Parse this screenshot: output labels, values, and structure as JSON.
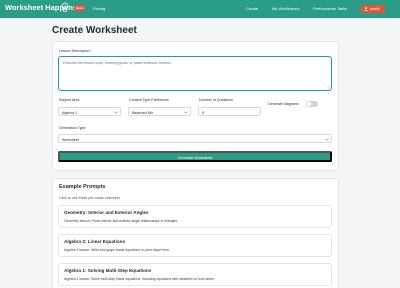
{
  "navbar": {
    "brand": "Worksheet Happens",
    "beta_badge": "Beta",
    "links": [
      "Pricing",
      "Create",
      "My Worksheets",
      "Performance Tasks"
    ],
    "user": "jonah9",
    "colors": {
      "nav_bg": "#2a9d86",
      "badge": "#e8554e",
      "user_chip": "#e0563b"
    }
  },
  "page": {
    "title": "Create Worksheet"
  },
  "form": {
    "lesson_label": "Lesson Description",
    "required_marker": "*",
    "lesson_placeholder": "Describe the lesson topic, learning goals, or paste textbook content...",
    "lesson_value": "",
    "subject_label": "Subject Area",
    "subject_value": "Algebra 1",
    "content_type_label": "Content Type Preference",
    "content_type_value": "Balanced Mix",
    "question_count_label": "Number of Questions",
    "question_count_value": "5",
    "diagrams_label": "Generate diagrams",
    "diagrams_enabled": false,
    "generation_type_label": "Generation Type",
    "generation_type_value": "Worksheet",
    "generate_button": "Generate Worksheet",
    "accent_color": "#2a9d86"
  },
  "examples": {
    "title": "Example Prompts",
    "subtitle": "Click to use these pre-made examples",
    "items": [
      {
        "title": "Geometry: Interior and Exterior Angles",
        "description": "Geometry lesson: Prove interior and exterior angle relationships in triangles."
      },
      {
        "title": "Algebra 2: Linear Equations",
        "description": "Algebra 2 lesson: Write and graph linear equations in point-slope form."
      },
      {
        "title": "Algebra 1: Solving Multi-Step Equations",
        "description": "Algebra 1 lesson: Solve multi-step linear equations, including equations with variables on both sides."
      }
    ]
  }
}
